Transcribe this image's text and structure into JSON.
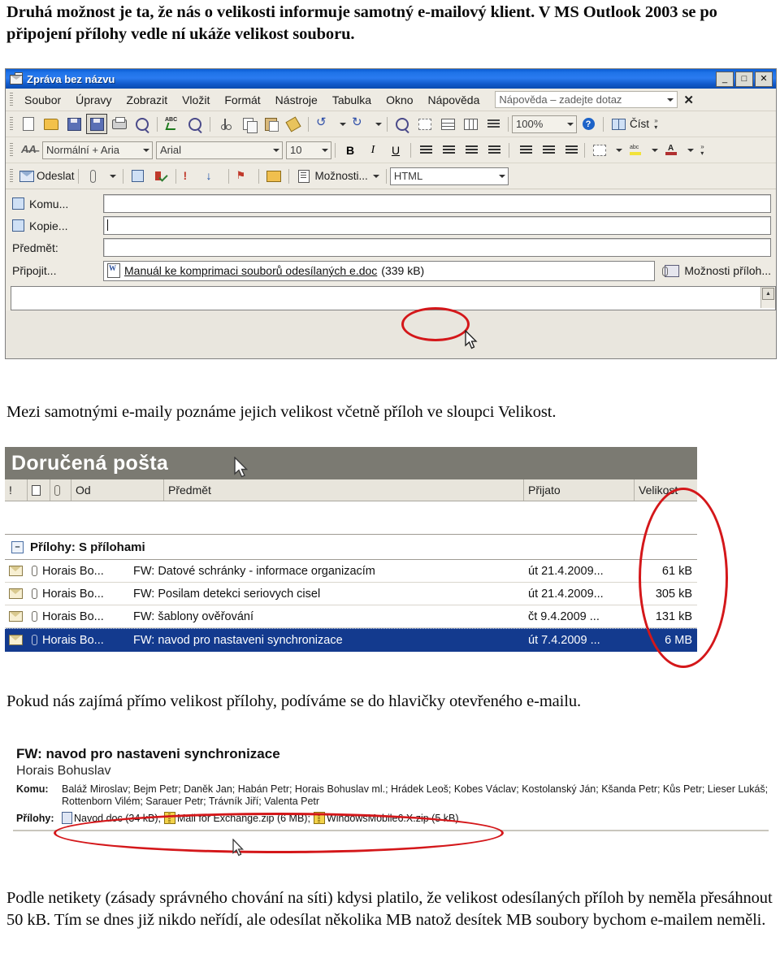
{
  "document": {
    "paragraph_1": "Druhá možnost je ta, že nás o velikosti informuje samotný e-mailový klient. V MS Outlook 2003 se po připojení přílohy vedle ní ukáže velikost souboru.",
    "paragraph_2": "Mezi samotnými e-maily poznáme jejich velikost včetně příloh ve sloupci Velikost.",
    "paragraph_3": "Pokud nás zajímá přímo velikost přílohy, podíváme se do hlavičky otevřeného e-mailu.",
    "paragraph_4": "Podle netikety (zásady správného chování na síti) kdysi platilo, že velikost odesílaných příloh by neměla přesáhnout 50 kB. Tím se dnes již nikdo neřídí, ale odesílat několika MB natož desítek MB soubory bychom e-mailem neměli."
  },
  "compose_window": {
    "title": "Zpráva bez názvu",
    "window_buttons": {
      "minimize": "_",
      "maximize": "□",
      "close": "✕"
    },
    "menu": [
      {
        "label": "Soubor",
        "accel": "S"
      },
      {
        "label": "Úpravy",
        "accel": "a"
      },
      {
        "label": "Zobrazit",
        "accel": "Z"
      },
      {
        "label": "Vložit",
        "accel": "l"
      },
      {
        "label": "Formát",
        "accel": "F"
      },
      {
        "label": "Nástroje",
        "accel": "N"
      },
      {
        "label": "Tabulka",
        "accel": "T"
      },
      {
        "label": "Okno",
        "accel": "O"
      },
      {
        "label": "Nápověda",
        "accel": "ě"
      }
    ],
    "help_box": {
      "text": "Nápověda – zadejte dotaz"
    },
    "menu_close_label": "✕",
    "standard_toolbar": {
      "icons": [
        "new-mail-icon",
        "open-folder-icon",
        "save-icon",
        "print-preview-icon",
        "print-icon",
        "preview-icon",
        "spelling-icon",
        "research-icon",
        "cut-icon",
        "copy-icon",
        "paste-icon",
        "format-painter-icon",
        "undo-icon",
        "redo-icon",
        "hyperlink-icon",
        "signature-icon",
        "table-icon",
        "insert-columns-icon",
        "paragraph-marks-icon",
        "help-icon"
      ],
      "zoom_value": "100%",
      "read_label": "Číst"
    },
    "formatting_toolbar": {
      "style_value": "Normální + Aria",
      "font_value": "Arial",
      "size_value": "10",
      "bold_label": "B",
      "italic_label": "I",
      "underline_label": "U"
    },
    "mail_toolbar": {
      "send_label": "Odeslat",
      "options_label": "Možnosti...",
      "format_value": "HTML",
      "icons": [
        "attach-file-icon",
        "address-book-icon",
        "check-names-icon",
        "high-importance-icon",
        "low-importance-icon",
        "flag-icon",
        "folder-icon",
        "options-icon"
      ]
    },
    "fields": {
      "to_label": "Komu...",
      "cc_label": "Kopie...",
      "subject_label": "Předmět:",
      "attach_label": "Připojit...",
      "to_value": "",
      "cc_value": "",
      "subject_value": "",
      "attachment_name": "Manuál ke komprimaci souborů odesílaných e.doc",
      "attachment_size": "(339 kB)",
      "attachment_options_label": "Možnosti příloh..."
    },
    "annotation": {
      "highlight": "339 kB attachment size circled in red"
    }
  },
  "inbox": {
    "title": "Doručená pošta",
    "columns": {
      "importance": "!",
      "icon": "",
      "attachment": "",
      "from": "Od",
      "subject": "Předmět",
      "received": "Přijato",
      "size": "Velikost"
    },
    "group_header": "Přílohy: S přílohami",
    "rows": [
      {
        "from": "Horais Bo...",
        "subject": "FW: Datové schránky - informace organizacím",
        "received": "út 21.4.2009...",
        "size": "61 kB",
        "selected": false
      },
      {
        "from": "Horais Bo...",
        "subject": "FW: Posilam detekci seriovych cisel",
        "received": "út 21.4.2009...",
        "size": "305 kB",
        "selected": false
      },
      {
        "from": "Horais Bo...",
        "subject": "FW: šablony ověřování",
        "received": "čt 9.4.2009 ...",
        "size": "131 kB",
        "selected": false
      },
      {
        "from": "Horais Bo...",
        "subject": "FW: navod pro nastaveni synchronizace",
        "received": "út 7.4.2009 ...",
        "size": "6 MB",
        "selected": true
      }
    ],
    "annotation": {
      "highlight": "Velikost column circled in red"
    }
  },
  "message_header": {
    "subject": "FW: navod pro nastaveni synchronizace",
    "from": "Horais Bohuslav",
    "to_label": "Komu:",
    "to_value_line1": "Baláž Miroslav; Bejm Petr; Daněk Jan; Habán Petr; Horais Bohuslav ml.; Hrádek Leoš; Kobes Václav; Kostolanský Ján; Kšanda Petr; Kůs Petr; Lieser Lukáš;",
    "to_value_line2": "Rottenborn Vilém; Sarauer Petr; Trávník Jiří; Valenta Petr",
    "attachments_label": "Přílohy:",
    "attachments": [
      {
        "icon": "word-doc-icon",
        "text": "Navod.doc (34 kB);"
      },
      {
        "icon": "zip-icon",
        "text": "Mail for Exchange.zip (6 MB);"
      },
      {
        "icon": "zip-icon",
        "text": "WindowsMobile6.X.zip (5 kB)"
      }
    ],
    "annotation": {
      "highlight": "attachment list circled in red"
    }
  },
  "colors": {
    "title_bar_blue": "#1f73e8",
    "selection_blue": "#133a8e",
    "annotation_red": "#d4171a",
    "toolbar_bg": "#eeebe3",
    "inbox_title_bg": "#7b7a72"
  }
}
